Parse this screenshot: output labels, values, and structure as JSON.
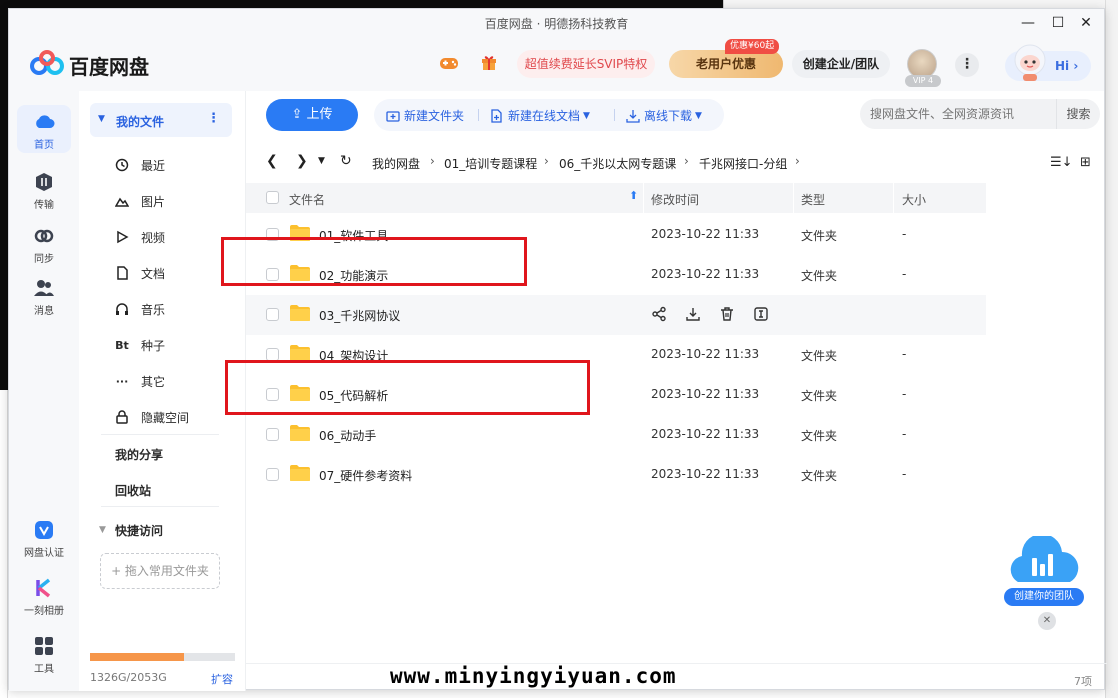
{
  "window": {
    "title": "百度网盘 · 明德扬科技教育",
    "minimize": "—",
    "maximize": "☐",
    "close": "✕"
  },
  "header": {
    "logo_text": "百度网盘",
    "svip_promo": "超值续费延长SVIP特权",
    "old_user": "老用户优惠",
    "coupon_badge": "优惠¥60起",
    "enterprise": "创建企业/团队",
    "vip_level": "VIP 4",
    "more": "⋮",
    "hi": "Hi ›"
  },
  "leftbar": [
    {
      "label": "首页",
      "icon": "cloud-icon",
      "active": true
    },
    {
      "label": "传输",
      "icon": "transfer-icon"
    },
    {
      "label": "同步",
      "icon": "sync-icon"
    },
    {
      "label": "消息",
      "icon": "message-icon"
    },
    {
      "label": "网盘认证",
      "icon": "verify-icon"
    },
    {
      "label": "一刻相册",
      "icon": "album-icon"
    },
    {
      "label": "工具",
      "icon": "tools-icon"
    }
  ],
  "sidebar": {
    "my_files": "我的文件",
    "items": [
      {
        "label": "最近",
        "icon": "clock-icon"
      },
      {
        "label": "图片",
        "icon": "image-icon"
      },
      {
        "label": "视频",
        "icon": "play-icon"
      },
      {
        "label": "文档",
        "icon": "document-icon"
      },
      {
        "label": "音乐",
        "icon": "headphone-icon"
      },
      {
        "label": "种子",
        "icon": "bt-icon",
        "glyph": "Bt"
      },
      {
        "label": "其它",
        "icon": "ellipsis-icon",
        "glyph": "···"
      },
      {
        "label": "隐藏空间",
        "icon": "lock-icon"
      }
    ],
    "my_share": "我的分享",
    "recycle": "回收站",
    "quick_access": "快捷访问",
    "drop_fav": "+ 拖入常用文件夹",
    "quota_text": "1326G/2053G",
    "quota_used_fraction": 0.646,
    "expand": "扩容"
  },
  "toolbar": {
    "upload": "上传",
    "new_folder": "新建文件夹",
    "new_online_doc": "新建在线文档",
    "offline_download": "离线下载",
    "search_placeholder": "搜网盘文件、全网资源资讯",
    "search_btn": "搜索"
  },
  "breadcrumb": [
    "我的网盘",
    "01_培训专题课程",
    "06_千兆以太网专题课",
    "千兆网接口-分组"
  ],
  "table": {
    "headers": {
      "name": "文件名",
      "time": "修改时间",
      "type": "类型",
      "size": "大小"
    },
    "rows": [
      {
        "name": "01_软件工具",
        "time": "2023-10-22 11:33",
        "type": "文件夹",
        "size": "-"
      },
      {
        "name": "02_功能演示",
        "time": "2023-10-22 11:33",
        "type": "文件夹",
        "size": "-",
        "highlighted": true
      },
      {
        "name": "03_千兆网协议",
        "time": "",
        "type": "",
        "size": "",
        "hover": true
      },
      {
        "name": "04_架构设计",
        "time": "2023-10-22 11:33",
        "type": "文件夹",
        "size": "-"
      },
      {
        "name": "05_代码解析",
        "time": "2023-10-22 11:33",
        "type": "文件夹",
        "size": "-",
        "highlighted": true
      },
      {
        "name": "06_动动手",
        "time": "2023-10-22 11:33",
        "type": "文件夹",
        "size": "-"
      },
      {
        "name": "07_硬件参考资料",
        "time": "2023-10-22 11:33",
        "type": "文件夹",
        "size": "-"
      }
    ]
  },
  "footer": {
    "count": "7项"
  },
  "team_widget": {
    "label": "创建你的团队"
  },
  "watermark": "www.minyingyiyuan.com",
  "colors": {
    "accent": "#2a7bf4",
    "highlight_box": "#e0161c",
    "folder": "#fcc02e"
  }
}
